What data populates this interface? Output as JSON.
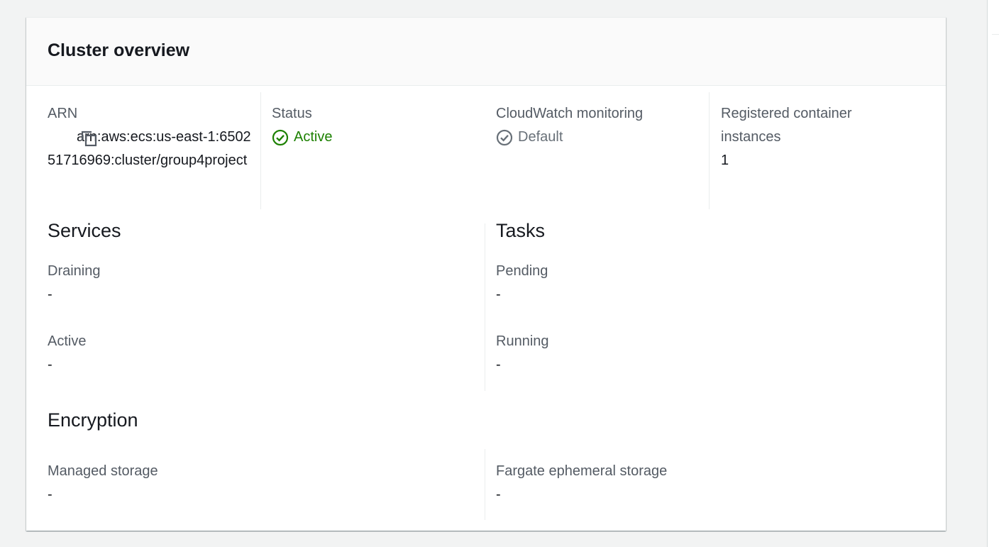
{
  "card": {
    "title": "Cluster overview"
  },
  "summary": {
    "arn": {
      "label": "ARN",
      "value": "arn:aws:ecs:us-east-1:650251716969:cluster/group4project"
    },
    "status": {
      "label": "Status",
      "value": "Active",
      "color": "#1d8102"
    },
    "cloudwatch": {
      "label": "CloudWatch monitoring",
      "value": "Default",
      "color": "#687078"
    },
    "instances": {
      "label": "Registered container instances",
      "value": "1"
    }
  },
  "services": {
    "title": "Services",
    "draining": {
      "label": "Draining",
      "value": "-"
    },
    "active": {
      "label": "Active",
      "value": "-"
    }
  },
  "tasks": {
    "title": "Tasks",
    "pending": {
      "label": "Pending",
      "value": "-"
    },
    "running": {
      "label": "Running",
      "value": "-"
    }
  },
  "encryption": {
    "title": "Encryption",
    "managed_storage": {
      "label": "Managed storage",
      "value": "-"
    },
    "fargate_storage": {
      "label": "Fargate ephemeral storage",
      "value": "-"
    }
  }
}
